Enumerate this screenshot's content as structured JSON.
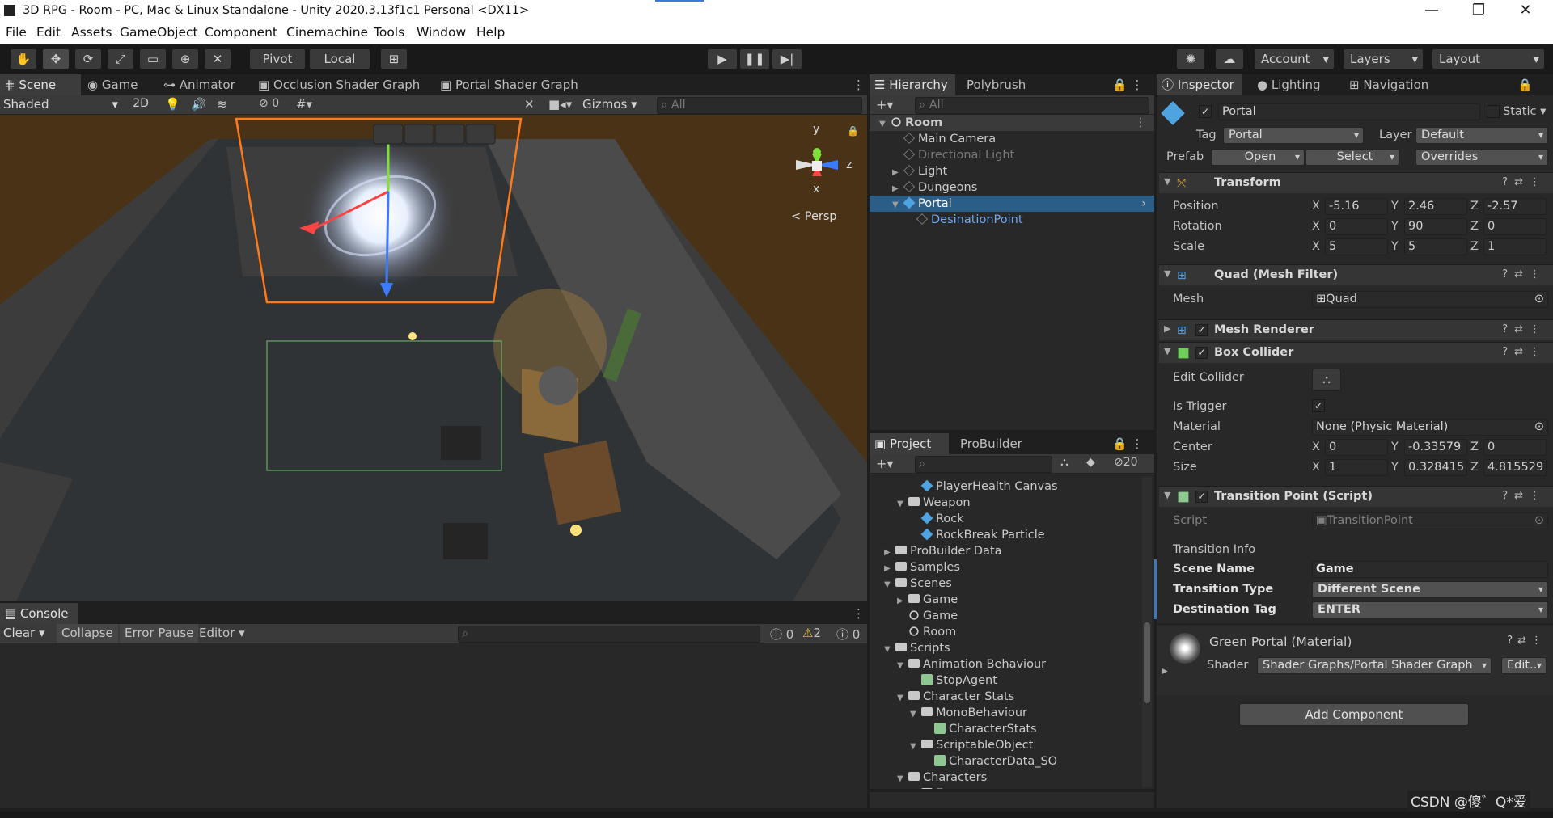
{
  "window": {
    "title": "3D RPG - Room - PC, Mac & Linux Standalone - Unity 2020.3.13f1c1 Personal <DX11>",
    "min": "—",
    "max": "❐",
    "close": "✕"
  },
  "menu": [
    "File",
    "Edit",
    "Assets",
    "GameObject",
    "Component",
    "Cinemachine",
    "Tools",
    "Window",
    "Help"
  ],
  "toolbar": {
    "pivot": "Pivot",
    "local": "Local",
    "account": "Account",
    "layers": "Layers",
    "layout": "Layout"
  },
  "scene_tabs": [
    "Scene",
    "Game",
    "Animator",
    "Occlusion Shader Graph",
    "Portal Shader Graph"
  ],
  "scene_bar": {
    "shading": "Shaded",
    "mode2d": "2D",
    "hidden_count": "0",
    "gizmos": "Gizmos",
    "search_placeholder": "All"
  },
  "scene_view": {
    "persp": "< Persp",
    "axis_x": "x",
    "axis_y": "y",
    "axis_z": "z"
  },
  "console": {
    "tab": "Console",
    "clear": "Clear",
    "collapse": "Collapse",
    "error_pause": "Error Pause",
    "editor": "Editor",
    "count_info": "0",
    "count_warn": "2",
    "count_err": "0"
  },
  "hierarchy": {
    "tabs": [
      "Hierarchy",
      "Polybrush"
    ],
    "search_placeholder": "All",
    "items": [
      {
        "label": "Room",
        "depth": 0,
        "icon": "unity",
        "expanded": true
      },
      {
        "label": "Main Camera",
        "depth": 1,
        "icon": "cubeo"
      },
      {
        "label": "Directional Light",
        "depth": 1,
        "icon": "cubeo",
        "disabled": true
      },
      {
        "label": "Light",
        "depth": 1,
        "icon": "cubeo",
        "collapsed": true
      },
      {
        "label": "Dungeons",
        "depth": 1,
        "icon": "cubeo",
        "collapsed": true
      },
      {
        "label": "Portal",
        "depth": 1,
        "icon": "cube",
        "selected": true,
        "expanded": true
      },
      {
        "label": "DesinationPoint",
        "depth": 2,
        "icon": "cubeo",
        "prefab": true
      }
    ]
  },
  "project": {
    "tabs": [
      "Project",
      "ProBuilder"
    ],
    "hidden_count": "20",
    "items": [
      {
        "label": "PlayerHealth Canvas",
        "depth": 3,
        "icon": "cube"
      },
      {
        "label": "Weapon",
        "depth": 2,
        "icon": "folder",
        "expanded": true
      },
      {
        "label": "Rock",
        "depth": 3,
        "icon": "cube"
      },
      {
        "label": "RockBreak Particle",
        "depth": 3,
        "icon": "cube"
      },
      {
        "label": "ProBuilder Data",
        "depth": 1,
        "icon": "folder",
        "collapsed": true
      },
      {
        "label": "Samples",
        "depth": 1,
        "icon": "folder",
        "collapsed": true
      },
      {
        "label": "Scenes",
        "depth": 1,
        "icon": "folder",
        "expanded": true
      },
      {
        "label": "Game",
        "depth": 2,
        "icon": "folder",
        "collapsed": true
      },
      {
        "label": "Game",
        "depth": 2,
        "icon": "unity"
      },
      {
        "label": "Room",
        "depth": 2,
        "icon": "unity"
      },
      {
        "label": "Scripts",
        "depth": 1,
        "icon": "folder",
        "expanded": true
      },
      {
        "label": "Animation Behaviour",
        "depth": 2,
        "icon": "folder",
        "expanded": true
      },
      {
        "label": "StopAgent",
        "depth": 3,
        "icon": "script"
      },
      {
        "label": "Character Stats",
        "depth": 2,
        "icon": "folder",
        "expanded": true
      },
      {
        "label": "MonoBehaviour",
        "depth": 3,
        "icon": "folder",
        "expanded": true
      },
      {
        "label": "CharacterStats",
        "depth": 4,
        "icon": "script"
      },
      {
        "label": "ScriptableObject",
        "depth": 3,
        "icon": "folder",
        "expanded": true
      },
      {
        "label": "CharacterData_SO",
        "depth": 4,
        "icon": "script"
      },
      {
        "label": "Characters",
        "depth": 2,
        "icon": "folder",
        "expanded": true
      },
      {
        "label": "Enemy",
        "depth": 3,
        "icon": "folder",
        "expanded": true
      }
    ]
  },
  "inspector": {
    "tabs": [
      "Inspector",
      "Lighting",
      "Navigation"
    ],
    "name": "Portal",
    "static": "Static",
    "tag_label": "Tag",
    "tag": "Portal",
    "layer_label": "Layer",
    "layer": "Default",
    "prefab_label": "Prefab",
    "open": "Open",
    "select": "Select",
    "overrides": "Overrides",
    "transform": {
      "title": "Transform",
      "position_label": "Position",
      "rotation_label": "Rotation",
      "scale_label": "Scale",
      "position": [
        "-5.16",
        "2.46",
        "-2.57"
      ],
      "rotation": [
        "0",
        "90",
        "0"
      ],
      "scale": [
        "5",
        "5",
        "1"
      ]
    },
    "mesh_filter": {
      "title": "Quad (Mesh Filter)",
      "mesh_label": "Mesh",
      "mesh": "Quad"
    },
    "mesh_renderer": {
      "title": "Mesh Renderer"
    },
    "box_collider": {
      "title": "Box Collider",
      "edit_label": "Edit Collider",
      "trigger_label": "Is Trigger",
      "material_label": "Material",
      "material": "None (Physic Material)",
      "center_label": "Center",
      "center": [
        "0",
        "-0.33579",
        "0"
      ],
      "size_label": "Size",
      "size": [
        "1",
        "0.328415",
        "4.815529"
      ]
    },
    "transition": {
      "title": "Transition Point (Script)",
      "script_label": "Script",
      "script": "TransitionPoint",
      "info": "Transition Info",
      "scene_name_label": "Scene Name",
      "scene_name": "Game",
      "type_label": "Transition Type",
      "type": "Different Scene",
      "dest_label": "Destination Tag",
      "dest": "ENTER"
    },
    "material": {
      "title": "Green Portal (Material)",
      "shader_label": "Shader",
      "shader": "Shader Graphs/Portal Shader Graph",
      "edit": "Edit..."
    },
    "add_component": "Add Component"
  },
  "axis": {
    "x": "X",
    "y": "Y",
    "z": "Z"
  },
  "watermark": "CSDN @傻゛Q*爱"
}
